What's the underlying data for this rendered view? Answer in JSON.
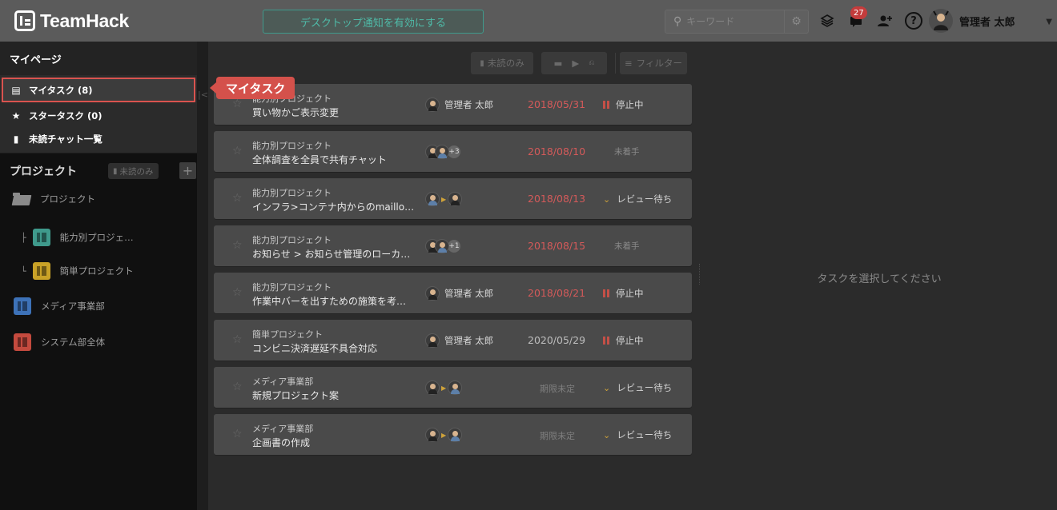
{
  "app": {
    "title": "TeamHack"
  },
  "header": {
    "notify_button": "デスクトップ通知を有効にする",
    "search_placeholder": "キーワード",
    "notification_count": "27",
    "user_name": "管理者 太郎"
  },
  "sidebar": {
    "mypage_title": "マイページ",
    "mypage_items": [
      {
        "label": "マイタスク (8)",
        "icon": "document-icon"
      },
      {
        "label": "スタータスク (0)",
        "icon": "star-icon"
      },
      {
        "label": "未読チャット一覧",
        "icon": "chat-icon"
      }
    ],
    "projects_title": "プロジェクト",
    "unread_only": "未読のみ",
    "add_label": "+",
    "tree": [
      {
        "label": "プロジェクト",
        "type": "folder"
      },
      {
        "label": "能力別プロジェ…",
        "type": "project",
        "color": "#3f9a8c"
      },
      {
        "label": "簡単プロジェクト",
        "type": "project",
        "color": "#c9a227"
      },
      {
        "label": "メディア事業部",
        "type": "project",
        "color": "#3d72b8"
      },
      {
        "label": "システム部全体",
        "type": "project",
        "color": "#c44a3e"
      }
    ]
  },
  "toolbar": {
    "unread_only": "未読のみ",
    "filter": "フィルター"
  },
  "tasks": [
    {
      "project": "能力別プロジェクト",
      "name": "買い物かご表示変更",
      "assignee": "管理者 太郎",
      "date": "2018/05/31",
      "date_style": "red",
      "status": "停止中",
      "status_icon": "pause"
    },
    {
      "project": "能力別プロジェクト",
      "name": "全体調査を全員で共有チャット",
      "assignee_more": "+3",
      "date": "2018/08/10",
      "date_style": "red",
      "status": "未着手",
      "status_icon": "none"
    },
    {
      "project": "能力別プロジェクト",
      "name": "インフラ>コンテナ内からのmaillo…",
      "date": "2018/08/13",
      "date_style": "red",
      "status": "レビュー待ち",
      "status_icon": "chevron"
    },
    {
      "project": "能力別プロジェクト",
      "name": "お知らせ > お知らせ管理のローカ…",
      "assignee_more": "+1",
      "date": "2018/08/15",
      "date_style": "red",
      "status": "未着手",
      "status_icon": "none"
    },
    {
      "project": "能力別プロジェクト",
      "name": "作業中バーを出すための施策を考…",
      "assignee": "管理者 太郎",
      "date": "2018/08/21",
      "date_style": "red",
      "status": "停止中",
      "status_icon": "pause"
    },
    {
      "project": "簡単プロジェクト",
      "name": "コンビニ決済遅延不具合対応",
      "assignee": "管理者 太郎",
      "date": "2020/05/29",
      "date_style": "gray",
      "status": "停止中",
      "status_icon": "pause"
    },
    {
      "project": "メディア事業部",
      "name": "新規プロジェクト案",
      "date": "期限未定",
      "date_style": "muted",
      "status": "レビュー待ち",
      "status_icon": "chevron"
    },
    {
      "project": "メディア事業部",
      "name": "企画書の作成",
      "date": "期限未定",
      "date_style": "muted",
      "status": "レビュー待ち",
      "status_icon": "chevron"
    }
  ],
  "right_panel": {
    "hint": "タスクを選択してください"
  },
  "tooltip": {
    "label": "マイタスク"
  },
  "colors": {
    "accent": "#3f9a8c",
    "highlight": "#d4514b",
    "date_overdue": "#d45a5a"
  }
}
